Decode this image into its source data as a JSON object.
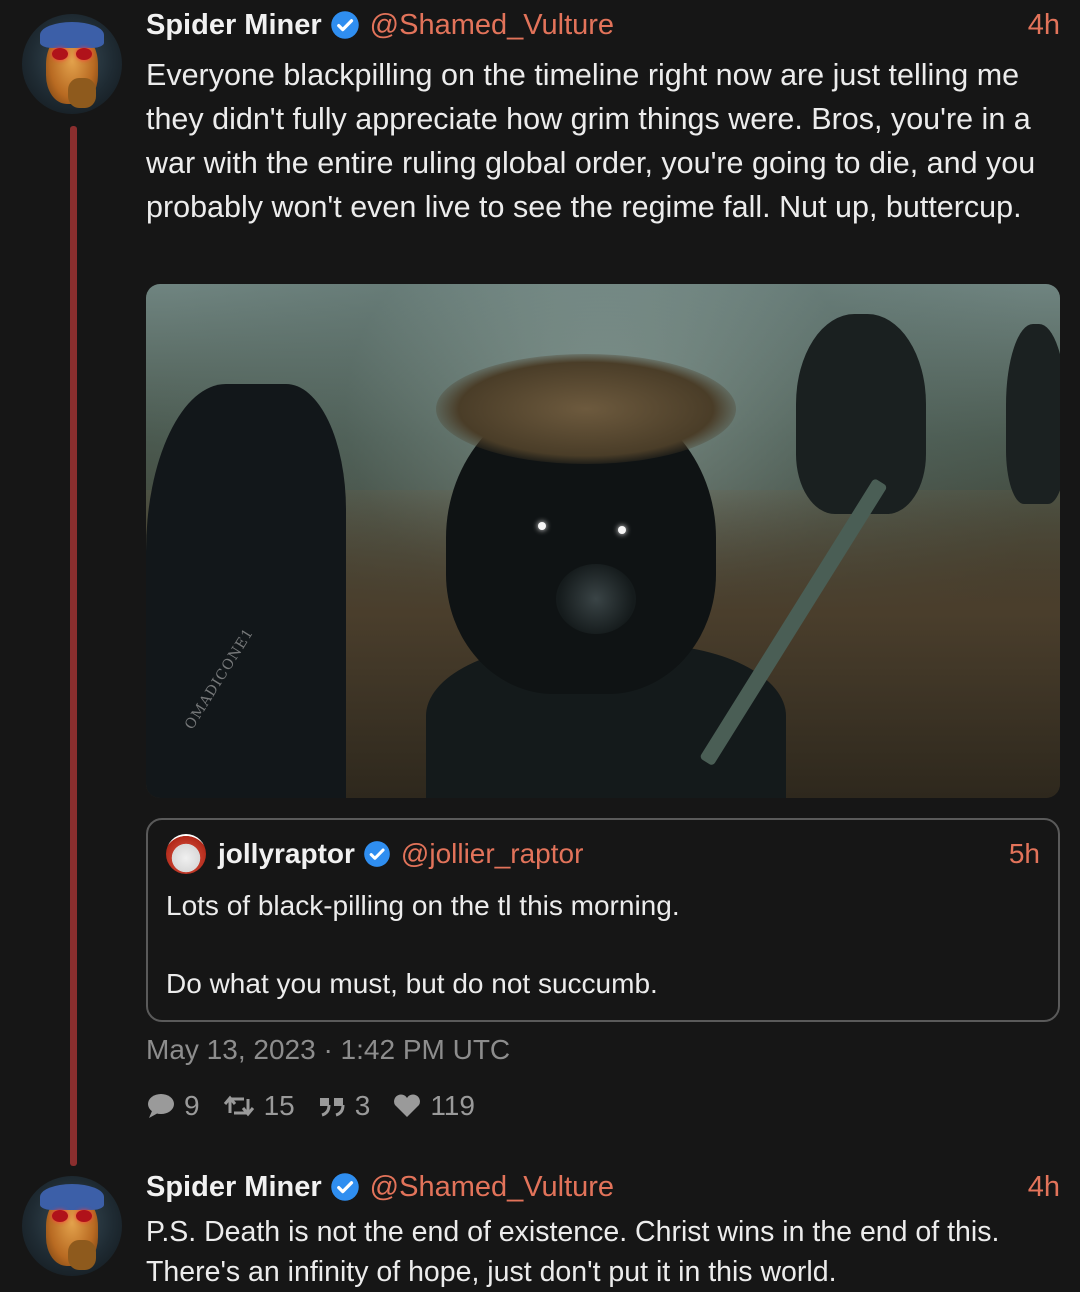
{
  "colors": {
    "background": "#161616",
    "accent": "#e2735a",
    "thread_line": "#8a2e2e",
    "verified": "#2f8ef0"
  },
  "tweets": [
    {
      "name": "Spider Miner",
      "handle": "@Shamed_Vulture",
      "time": "4h",
      "text": "Everyone blackpilling on the timeline right now are just telling me they didn't fully appreciate how grim things were. Bros, you're in a war with the entire ruling global order, you're going to die, and you probably won't even live to see the regime fall. Nut up, buttercup.",
      "media": {
        "watermark": "OMADICONE1"
      },
      "quote": {
        "name": "jollyraptor",
        "handle": "@jollier_raptor",
        "time": "5h",
        "text": "Lots of black-pilling on the tl this morning.\n\nDo what you must, but do not succumb."
      },
      "date": "May 13, 2023 · 1:42 PM UTC",
      "stats": {
        "replies": "9",
        "retweets": "15",
        "quotes": "3",
        "likes": "119"
      }
    },
    {
      "name": "Spider Miner",
      "handle": "@Shamed_Vulture",
      "time": "4h",
      "text": "P.S. Death is not the end of existence. Christ wins in the end of this. There's an infinity of hope, just don't put it in this world."
    }
  ]
}
